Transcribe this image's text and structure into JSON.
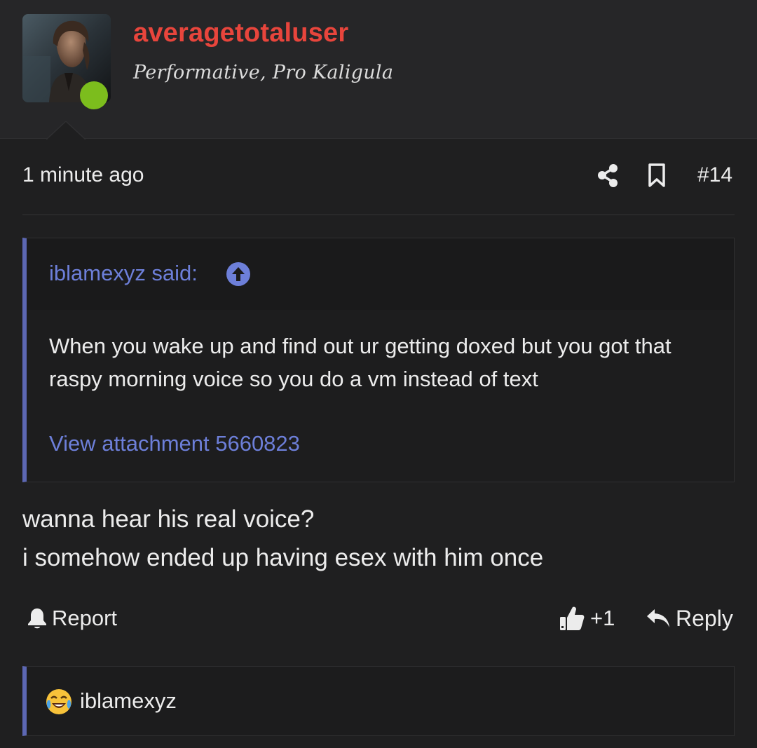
{
  "author": {
    "username": "averagetotaluser",
    "title": "Performative, Pro Kaligula",
    "online_status_color": "#7cbd1d"
  },
  "post": {
    "timestamp": "1 minute ago",
    "number": "#14",
    "body_lines": [
      "wanna hear his real voice?",
      "i somehow ended up having esex with him once"
    ]
  },
  "quote": {
    "author_label": "iblamexyz said:",
    "text": "When you wake up and find out ur getting doxed but you got that raspy morning voice so you do a vm instead of text",
    "attachment_link": "View attachment 5660823"
  },
  "actions": {
    "report_label": "Report",
    "like_count": "+1",
    "reply_label": "Reply"
  },
  "reactions": {
    "emoji_icon": "face-with-tears-of-joy-icon",
    "users": "iblamexyz"
  },
  "icons": {
    "share": "share-icon",
    "bookmark": "bookmark-icon",
    "quote_jump": "arrow-up-circle-icon",
    "report": "bell-icon",
    "like": "thumbs-up-icon",
    "reply": "reply-arrow-icon"
  },
  "colors": {
    "username": "#e8453c",
    "link": "#6d7fd9",
    "quote_accent": "#5c67b3",
    "background": "#1f1f20"
  }
}
